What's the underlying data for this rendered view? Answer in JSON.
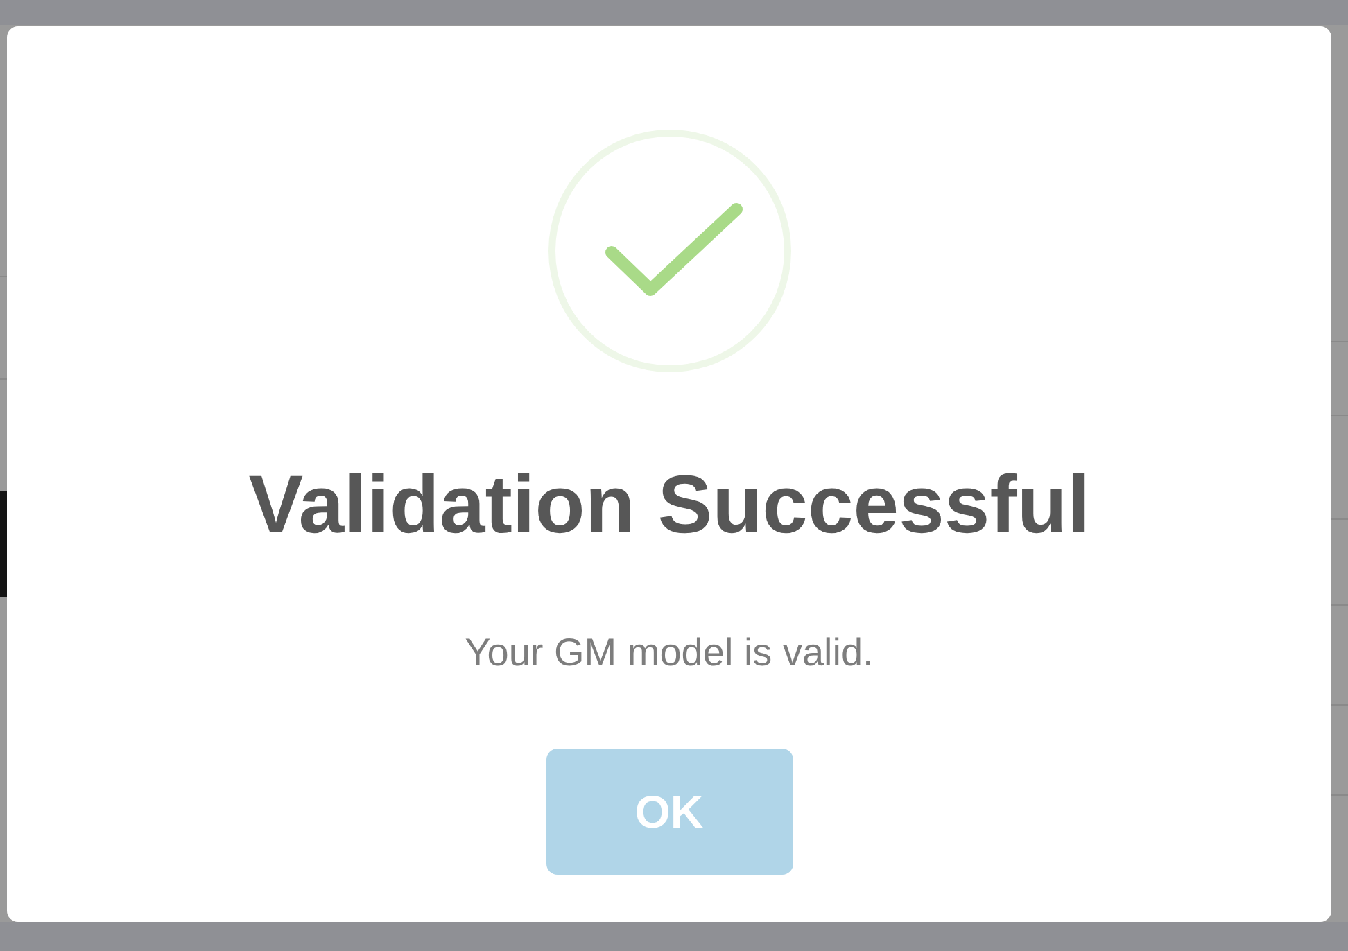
{
  "dialog": {
    "title": "Validation Successful",
    "message": "Your GM model is valid.",
    "buttons": [
      {
        "label": "OK"
      }
    ]
  }
}
